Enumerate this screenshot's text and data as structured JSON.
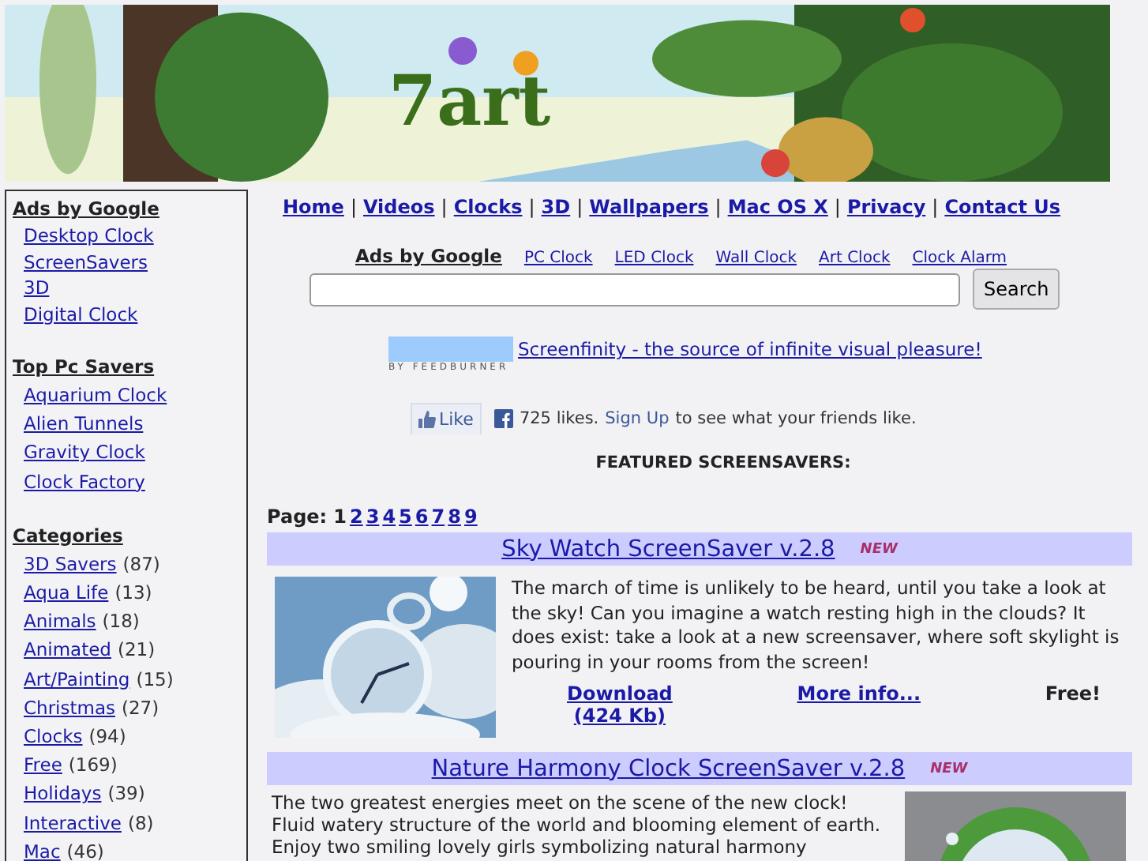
{
  "banner": {
    "logo": "7art"
  },
  "sidebar": [
    {
      "title": "Ads by Google",
      "items": [
        {
          "label": "Desktop Clock"
        },
        {
          "label": "ScreenSavers"
        },
        {
          "label": "3D"
        },
        {
          "label": "Digital Clock"
        }
      ]
    },
    {
      "title": "Top Pc Savers",
      "items": [
        {
          "label": "Aquarium Clock"
        },
        {
          "label": "Alien Tunnels"
        },
        {
          "label": "Gravity Clock"
        },
        {
          "label": "Clock Factory"
        }
      ]
    },
    {
      "title": "Categories",
      "items": [
        {
          "label": "3D Savers",
          "count": "(87)"
        },
        {
          "label": "Aqua Life",
          "count": "(13)"
        },
        {
          "label": "Animals",
          "count": "(18)"
        },
        {
          "label": "Animated",
          "count": "(21)"
        },
        {
          "label": "Art/Painting",
          "count": "(15)"
        },
        {
          "label": "Christmas",
          "count": "(27)"
        },
        {
          "label": "Clocks",
          "count": "(94)"
        },
        {
          "label": "Free",
          "count": "(169)"
        },
        {
          "label": "Holidays",
          "count": "(39)"
        },
        {
          "label": "Interactive",
          "count": "(8)"
        },
        {
          "label": "Mac",
          "count": "(46)"
        }
      ]
    }
  ],
  "nav": [
    "Home",
    "Videos",
    "Clocks",
    "3D",
    "Wallpapers",
    "Mac OS X",
    "Privacy",
    "Contact Us"
  ],
  "nav_separator": "|",
  "ads": {
    "label": "Ads by Google",
    "links": [
      "PC Clock",
      "LED Clock",
      "Wall Clock",
      "Art Clock",
      "Clock Alarm"
    ]
  },
  "search": {
    "button": "Search"
  },
  "feed": {
    "caption": "BY FEEDBURNER",
    "link": "Screenfinity - the source of infinite visual pleasure!"
  },
  "facebook": {
    "like": "Like",
    "count": "725 likes.",
    "signup": "Sign Up",
    "rest": "to see what your friends like."
  },
  "featured_heading": "FEATURED SCREENSAVERS:",
  "pagination": {
    "label": "Page:",
    "pages": [
      {
        "label": "1",
        "selected": true
      },
      {
        "label": "2",
        "selected": false
      },
      {
        "label": "3",
        "selected": false
      },
      {
        "label": "4",
        "selected": false
      },
      {
        "label": "5",
        "selected": false
      },
      {
        "label": "6",
        "selected": false
      },
      {
        "label": "7",
        "selected": false
      },
      {
        "label": "8",
        "selected": false
      },
      {
        "label": "9",
        "selected": false
      }
    ]
  },
  "items": [
    {
      "title": "Sky Watch ScreenSaver v.2.8",
      "badge": "NEW",
      "kind": "image-left",
      "description": "The march of time is unlikely to be heard, until you take a look at the sky! Can you imagine a watch resting high in the clouds? It does exist: take a look at a new screensaver, where soft skylight is pouring in your rooms from the screen!",
      "download": "Download",
      "size": "(424 Kb)",
      "more": "More info...",
      "price": "Free!"
    },
    {
      "title": "Nature Harmony Clock ScreenSaver v.2.8",
      "badge": "NEW",
      "kind": "image-right",
      "description": "The two greatest energies meet on the scene of the new clock! Fluid watery structure of the world and blooming element of earth. Enjoy two smiling lovely girls symbolizing natural harmony"
    }
  ]
}
